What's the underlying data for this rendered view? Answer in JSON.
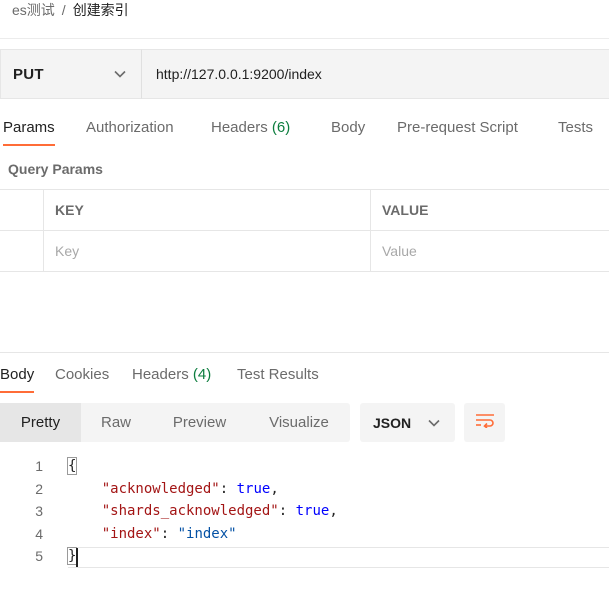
{
  "breadcrumb": {
    "parent": "es测试",
    "separator": "/",
    "current": "创建索引"
  },
  "request": {
    "method": "PUT",
    "url": "http://127.0.0.1:9200/index"
  },
  "request_tabs": [
    {
      "label": "Params",
      "count": ""
    },
    {
      "label": "Authorization",
      "count": ""
    },
    {
      "label": "Headers",
      "count": "(6)"
    },
    {
      "label": "Body",
      "count": ""
    },
    {
      "label": "Pre-request Script",
      "count": ""
    },
    {
      "label": "Tests",
      "count": ""
    }
  ],
  "query_params": {
    "title": "Query Params",
    "columns": [
      "KEY",
      "VALUE"
    ],
    "placeholders": [
      "Key",
      "Value"
    ]
  },
  "response_tabs": [
    {
      "label": "Body",
      "count": ""
    },
    {
      "label": "Cookies",
      "count": ""
    },
    {
      "label": "Headers",
      "count": "(4)"
    },
    {
      "label": "Test Results",
      "count": ""
    }
  ],
  "view_modes": [
    "Pretty",
    "Raw",
    "Preview",
    "Visualize"
  ],
  "format": "JSON",
  "code_lines": [
    {
      "n": "1",
      "text": "{"
    },
    {
      "n": "2",
      "key": "\"acknowledged\"",
      "value": "true"
    },
    {
      "n": "3",
      "key": "\"shards_acknowledged\"",
      "value": "true"
    },
    {
      "n": "4",
      "key": "\"index\"",
      "value": "\"index\""
    },
    {
      "n": "5",
      "text": "}"
    }
  ],
  "colors": {
    "accent": "#ff6c37",
    "count": "#0c7d3e",
    "json_key": "#a31515",
    "json_bool": "#0000ff",
    "json_string": "#0451a5"
  },
  "icons": {
    "method_dropdown": "chevron-down-icon",
    "format_dropdown": "chevron-down-icon",
    "wrap": "wrap-lines-icon"
  }
}
